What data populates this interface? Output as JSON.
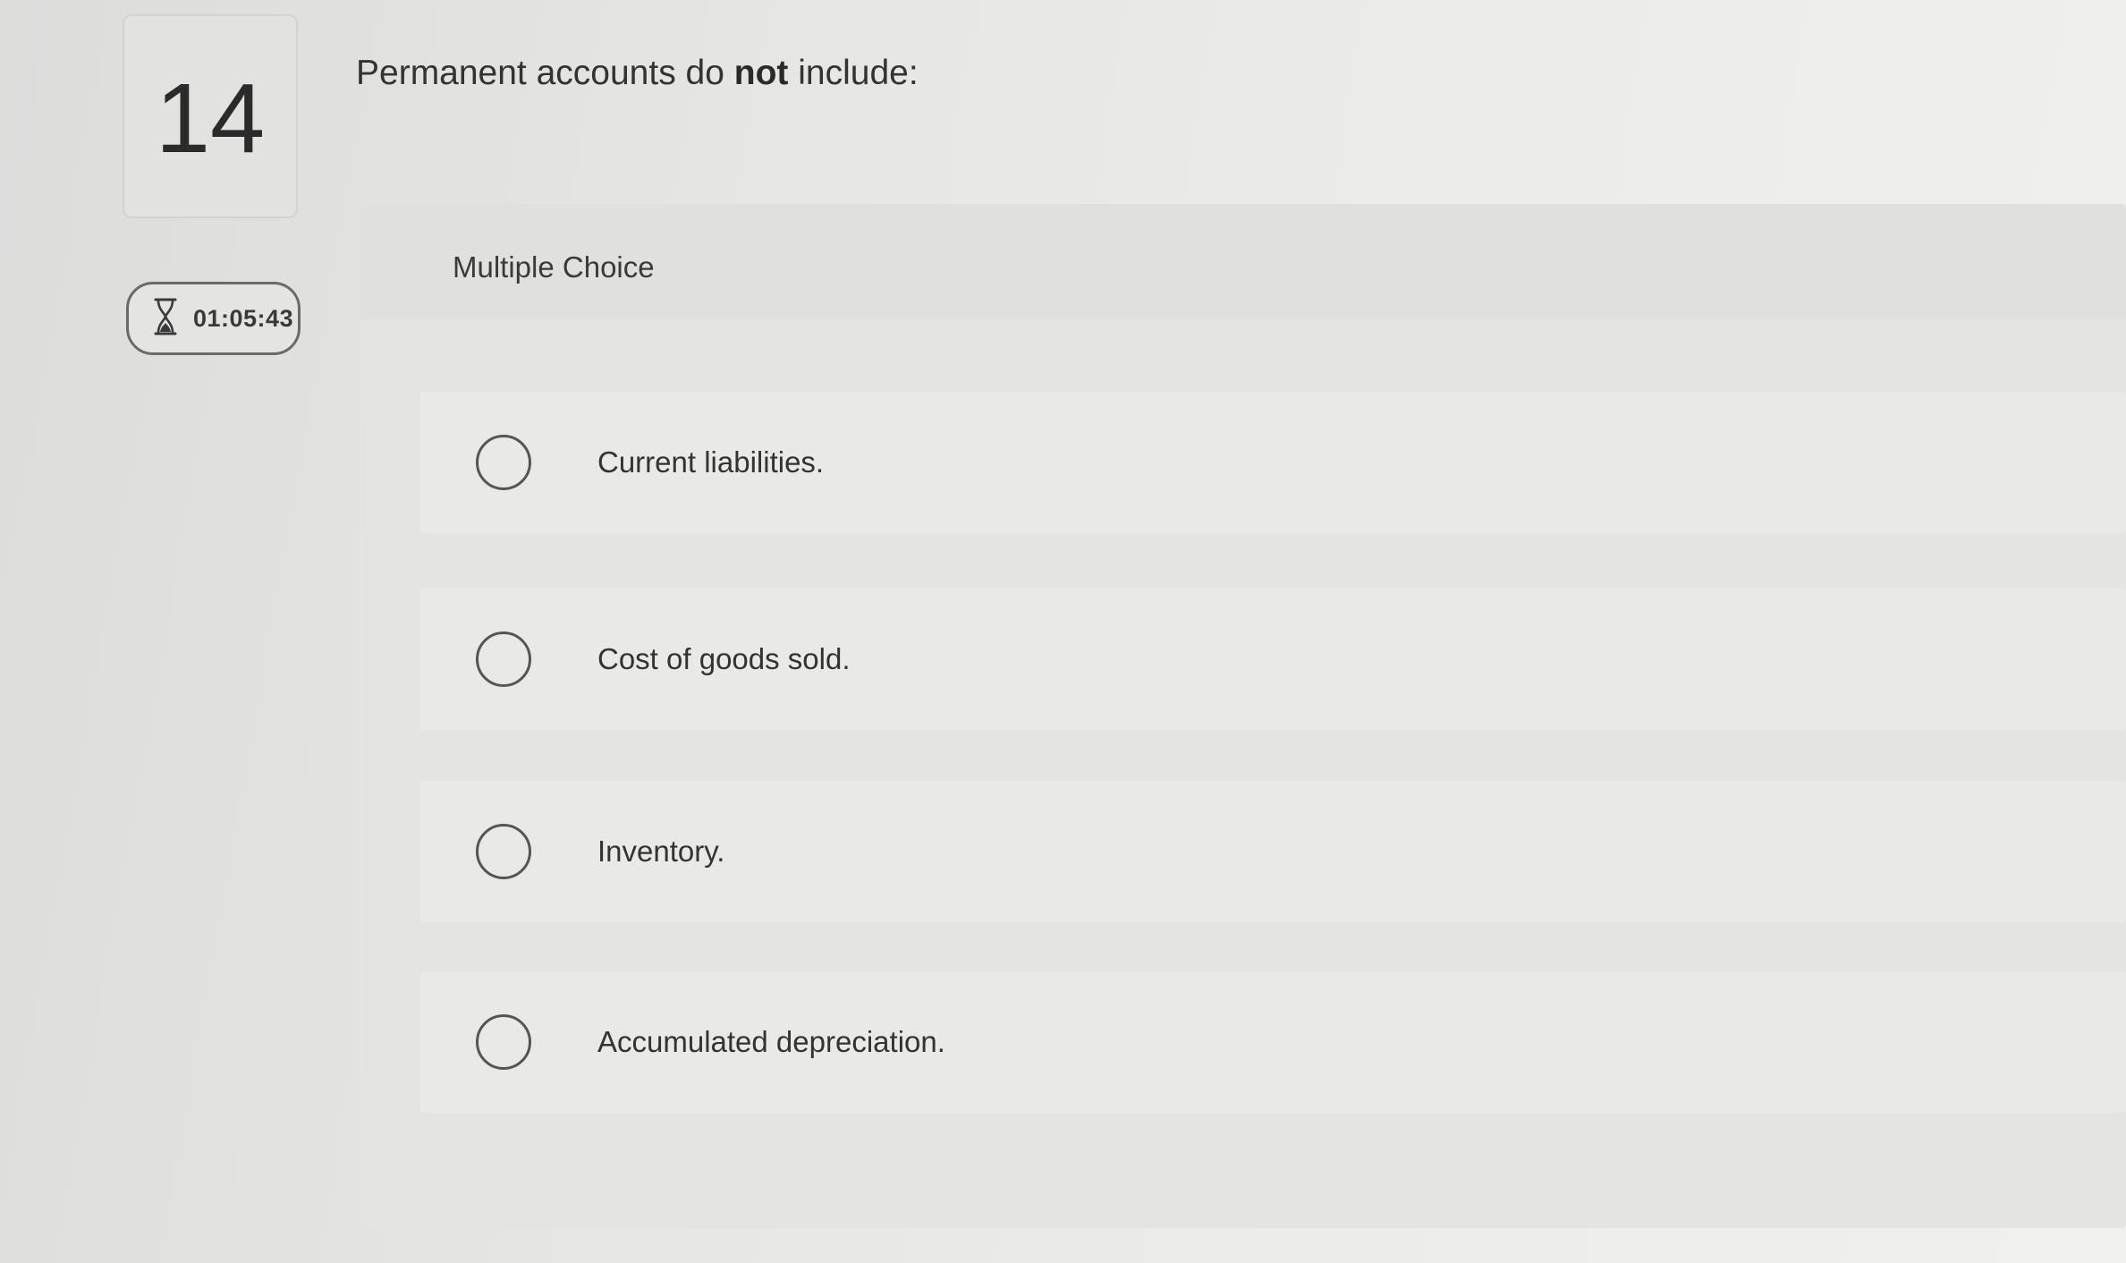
{
  "question": {
    "number": "14",
    "prompt_before": "Permanent accounts do ",
    "prompt_emphasis": "not",
    "prompt_after": " include:"
  },
  "timer": {
    "icon": "hourglass-icon",
    "time": "01:05:43"
  },
  "answer_panel": {
    "type_label": "Multiple Choice",
    "options": [
      {
        "label": "Current liabilities.",
        "selected": false
      },
      {
        "label": "Cost of goods sold.",
        "selected": false
      },
      {
        "label": "Inventory.",
        "selected": false
      },
      {
        "label": "Accumulated depreciation.",
        "selected": false
      }
    ]
  }
}
